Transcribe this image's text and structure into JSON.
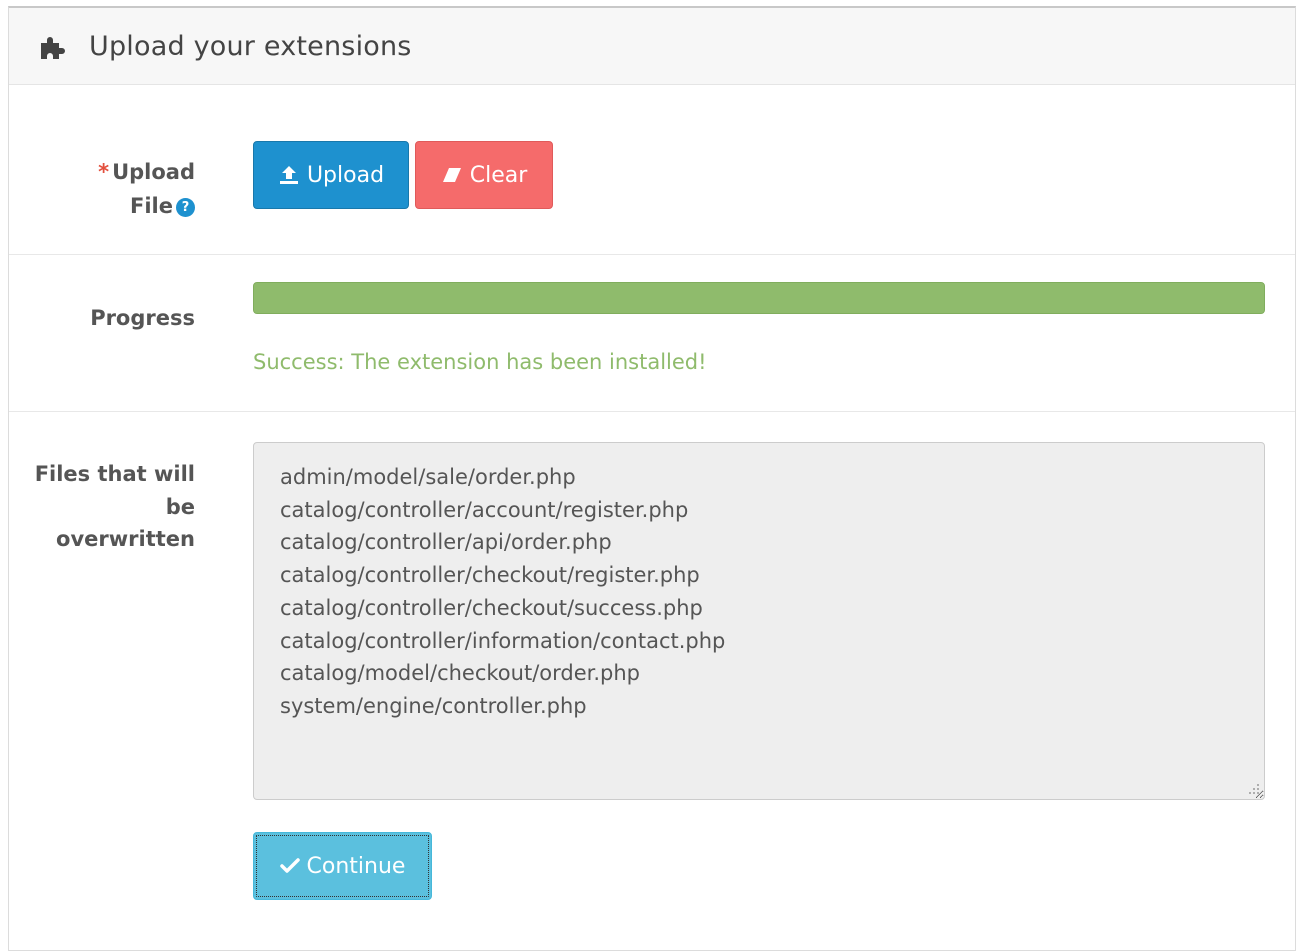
{
  "panel": {
    "title": "Upload your extensions",
    "icon": "puzzle-icon"
  },
  "upload": {
    "required_mark": "*",
    "label_line1": "Upload",
    "label_line2": "File",
    "help_icon": "?",
    "upload_button": "Upload",
    "clear_button": "Clear"
  },
  "progress": {
    "label": "Progress",
    "percent": 100,
    "message": "Success: The extension has been installed!"
  },
  "overwrite": {
    "label_line1": "Files that will",
    "label_line2": "be",
    "label_line3": "overwritten",
    "files": [
      "admin/model/sale/order.php",
      "catalog/controller/account/register.php",
      "catalog/controller/api/order.php",
      "catalog/controller/checkout/register.php",
      "catalog/controller/checkout/success.php",
      "catalog/controller/information/contact.php",
      "catalog/model/checkout/order.php",
      "system/engine/controller.php"
    ]
  },
  "actions": {
    "continue_button": "Continue"
  },
  "colors": {
    "primary": "#1e91cf",
    "danger": "#f56b6b",
    "success": "#8fbb6c",
    "info": "#5bc0de"
  }
}
